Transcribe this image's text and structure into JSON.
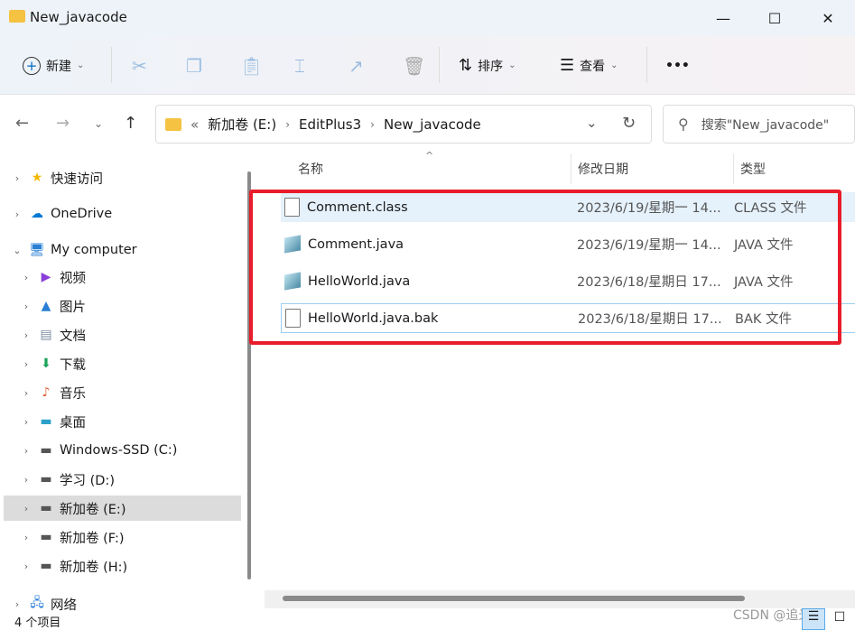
{
  "window": {
    "title": "New_javacode",
    "minimize": "—",
    "maximize": "☐",
    "close": "✕"
  },
  "toolbar": {
    "new_label": "新建",
    "sort_label": "排序",
    "view_label": "查看",
    "more_label": "•••"
  },
  "address": {
    "overflow": "«",
    "crumbs": [
      "新加卷 (E:)",
      "EditPlus3",
      "New_javacode"
    ],
    "search_placeholder": "搜索\"New_javacode\""
  },
  "sidebar": {
    "items": [
      {
        "label": "快速访问",
        "icon": "star-icon",
        "level": 0,
        "expand": "›"
      },
      {
        "label": "OneDrive",
        "icon": "cloud-icon",
        "level": 0,
        "expand": "›"
      },
      {
        "label": "My  computer",
        "icon": "computer-icon",
        "level": 0,
        "expand": "⌄"
      },
      {
        "label": "视频",
        "icon": "video-icon",
        "level": 1,
        "expand": "›"
      },
      {
        "label": "图片",
        "icon": "picture-icon",
        "level": 1,
        "expand": "›"
      },
      {
        "label": "文档",
        "icon": "document-icon",
        "level": 1,
        "expand": "›"
      },
      {
        "label": "下载",
        "icon": "download-icon",
        "level": 1,
        "expand": "›"
      },
      {
        "label": "音乐",
        "icon": "music-icon",
        "level": 1,
        "expand": "›"
      },
      {
        "label": "桌面",
        "icon": "desktop-icon",
        "level": 1,
        "expand": "›"
      },
      {
        "label": "Windows-SSD (C:)",
        "icon": "drive-icon",
        "level": 1,
        "expand": "›"
      },
      {
        "label": "学习 (D:)",
        "icon": "drive-icon",
        "level": 1,
        "expand": "›"
      },
      {
        "label": "新加卷 (E:)",
        "icon": "drive-icon",
        "level": 1,
        "expand": "›",
        "selected": true
      },
      {
        "label": "新加卷 (F:)",
        "icon": "drive-icon",
        "level": 1,
        "expand": "›"
      },
      {
        "label": "新加卷 (H:)",
        "icon": "drive-icon",
        "level": 1,
        "expand": "›"
      },
      {
        "label": "网络",
        "icon": "network-icon",
        "level": 0,
        "expand": "›"
      }
    ]
  },
  "columns": {
    "name": "名称",
    "date": "修改日期",
    "type": "类型"
  },
  "files": [
    {
      "name": "Comment.class",
      "date": "2023/6/19/星期一 14...",
      "type": "CLASS 文件",
      "icon": "file-icon"
    },
    {
      "name": "Comment.java",
      "date": "2023/6/19/星期一 14...",
      "type": "JAVA 文件",
      "icon": "java-file-icon"
    },
    {
      "name": "HelloWorld.java",
      "date": "2023/6/18/星期日 17...",
      "type": "JAVA 文件",
      "icon": "java-file-icon"
    },
    {
      "name": "HelloWorld.java.bak",
      "date": "2023/6/18/星期日 17...",
      "type": "BAK 文件",
      "icon": "file-icon"
    }
  ],
  "status": {
    "count": "4 个项目"
  },
  "watermark": "CSDN @追光者",
  "colors": {
    "highlight_box": "#e81c2a",
    "selected_row": "#e5f1fb",
    "accent": "#0078d4"
  }
}
